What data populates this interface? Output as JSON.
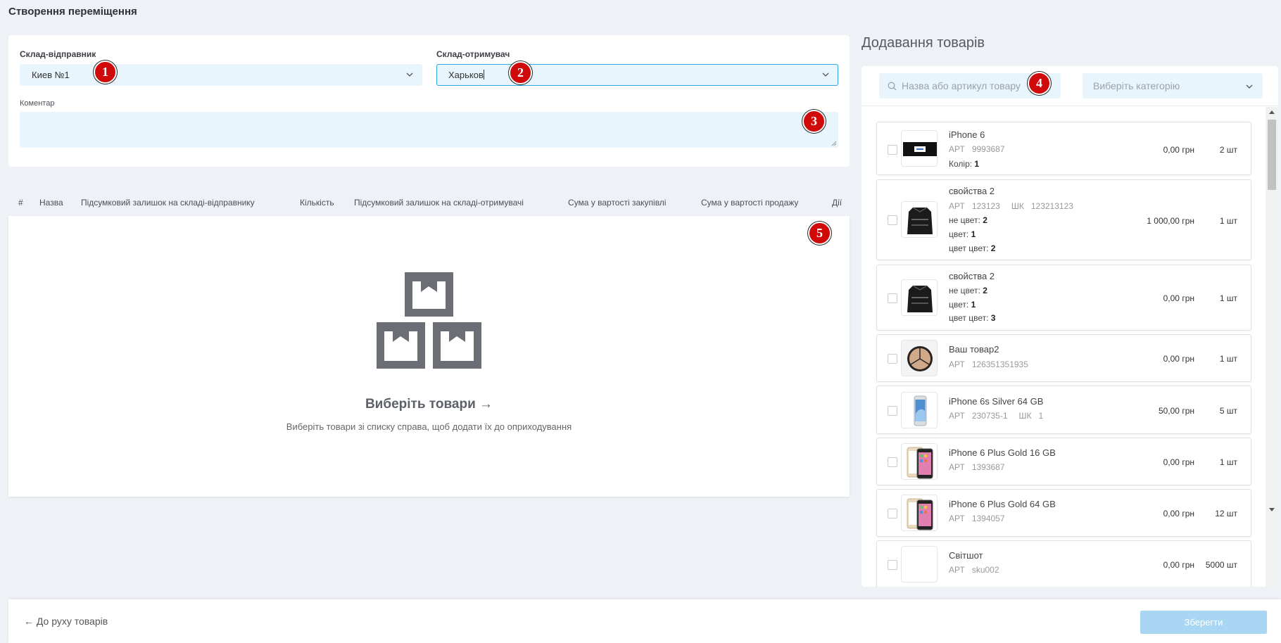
{
  "page": {
    "title": "Створення переміщення"
  },
  "form": {
    "sender_label": "Склад-відправник",
    "sender_value": "Киев №1",
    "receiver_label": "Склад-отримувач",
    "receiver_value": "Харьков",
    "comment_label": "Коментар",
    "comment_value": ""
  },
  "markers": [
    "1",
    "2",
    "3",
    "4",
    "5"
  ],
  "table": {
    "headers": [
      "#",
      "Назва",
      "Підсумковий залишок на складі-відправнику",
      "Кількість",
      "Підсумковий залишок на складі-отримувачі",
      "Сума у вартості закупівлі",
      "Сума у вартості продажу",
      "Дії"
    ]
  },
  "empty_state": {
    "title": "Виберіть товари →",
    "subtitle": "Виберіть товари зі списку справа, щоб додати їх до оприходування"
  },
  "panel": {
    "title": "Додавання товарів",
    "search_placeholder": "Назва або артикул товару",
    "category_placeholder": "Виберіть категорію"
  },
  "products": [
    {
      "name": "iPhone 6",
      "art_label": "АРТ",
      "art": "9993687",
      "attrs": [
        {
          "k": "Колір:",
          "v": "1"
        }
      ],
      "price": "0,00 грн",
      "qty": "2 шт",
      "thumb": "black-banner"
    },
    {
      "name": "свойства 2",
      "art_label": "АРТ",
      "art": "123123",
      "bc_label": "ШК",
      "bc": "123213123",
      "attrs": [
        {
          "k": "не цвет:",
          "v": "2"
        },
        {
          "k": "цвет:",
          "v": "1"
        },
        {
          "k": "цвет цвет:",
          "v": "2"
        }
      ],
      "price": "1 000,00 грн",
      "qty": "1 шт",
      "thumb": "jacket"
    },
    {
      "name": "свойства 2",
      "attrs": [
        {
          "k": "не цвет:",
          "v": "2"
        },
        {
          "k": "цвет:",
          "v": "1"
        },
        {
          "k": "цвет цвет:",
          "v": "3"
        }
      ],
      "price": "0,00 грн",
      "qty": "1 шт",
      "thumb": "jacket"
    },
    {
      "name": "Ваш товар2",
      "art_label": "АРТ",
      "art": "126351351935",
      "attrs": [],
      "price": "0,00 грн",
      "qty": "1 шт",
      "thumb": "compact"
    },
    {
      "name": "iPhone 6s Silver 64 GB",
      "art_label": "АРТ",
      "art": "230735-1",
      "bc_label": "ШК",
      "bc": "1",
      "attrs": [],
      "price": "50,00 грн",
      "qty": "5 шт",
      "thumb": "iphone-silver"
    },
    {
      "name": "iPhone 6 Plus Gold 16 GB",
      "art_label": "АРТ",
      "art": "1393687",
      "attrs": [],
      "price": "0,00 грн",
      "qty": "1 шт",
      "thumb": "iphone-gold"
    },
    {
      "name": "iPhone 6 Plus Gold 64 GB",
      "art_label": "АРТ",
      "art": "1394057",
      "attrs": [],
      "price": "0,00 грн",
      "qty": "12 шт",
      "thumb": "iphone-gold"
    },
    {
      "name": "Світшот",
      "art_label": "АРТ",
      "art": "sku002",
      "attrs": [],
      "price": "0,00 грн",
      "qty": "5000 шт",
      "thumb": "empty"
    }
  ],
  "footer": {
    "back_label": "До руху товарів",
    "save_label": "Зберегти"
  },
  "colors": {
    "accent": "#2fa6dc",
    "field_bg": "#e8f5fd",
    "marker": "#d00a0a",
    "save_disabled": "#a9d7f3"
  }
}
